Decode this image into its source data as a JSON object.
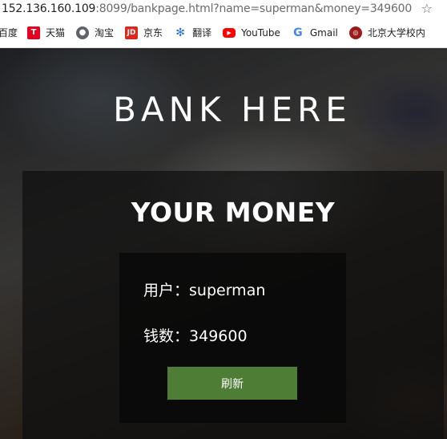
{
  "browser": {
    "url_host": "152.136.160.109",
    "url_rest": ":8099/bankpage.html?name=superman&money=349600",
    "star_icon": "star-icon",
    "bookmarks": [
      {
        "label": "百度",
        "icon": "baidu-icon",
        "color": "#ffffff"
      },
      {
        "label": "天猫",
        "icon": "tmall-icon",
        "color": "#e6001f"
      },
      {
        "label": "淘宝",
        "icon": "taobao-globe-icon",
        "color": "#5f6368"
      },
      {
        "label": "京东",
        "icon": "jd-icon",
        "color": "#e1251b"
      },
      {
        "label": "翻译",
        "icon": "baidu-paw-icon",
        "color": "#2f6fe4"
      },
      {
        "label": "YouTube",
        "icon": "youtube-icon",
        "color": "#ff0000"
      },
      {
        "label": "Gmail",
        "icon": "google-icon",
        "color": "#4285f4"
      },
      {
        "label": "北京大学校内",
        "icon": "pku-icon",
        "color": "#9c1a1a"
      }
    ]
  },
  "page": {
    "site_title": "BANK HERE",
    "panel_title": "YOUR MONEY",
    "user_label": "用户：",
    "user_value": "superman",
    "money_label": "钱数：",
    "money_value": "349600",
    "refresh_button": "刷新",
    "button_color": "#4e7d36"
  }
}
